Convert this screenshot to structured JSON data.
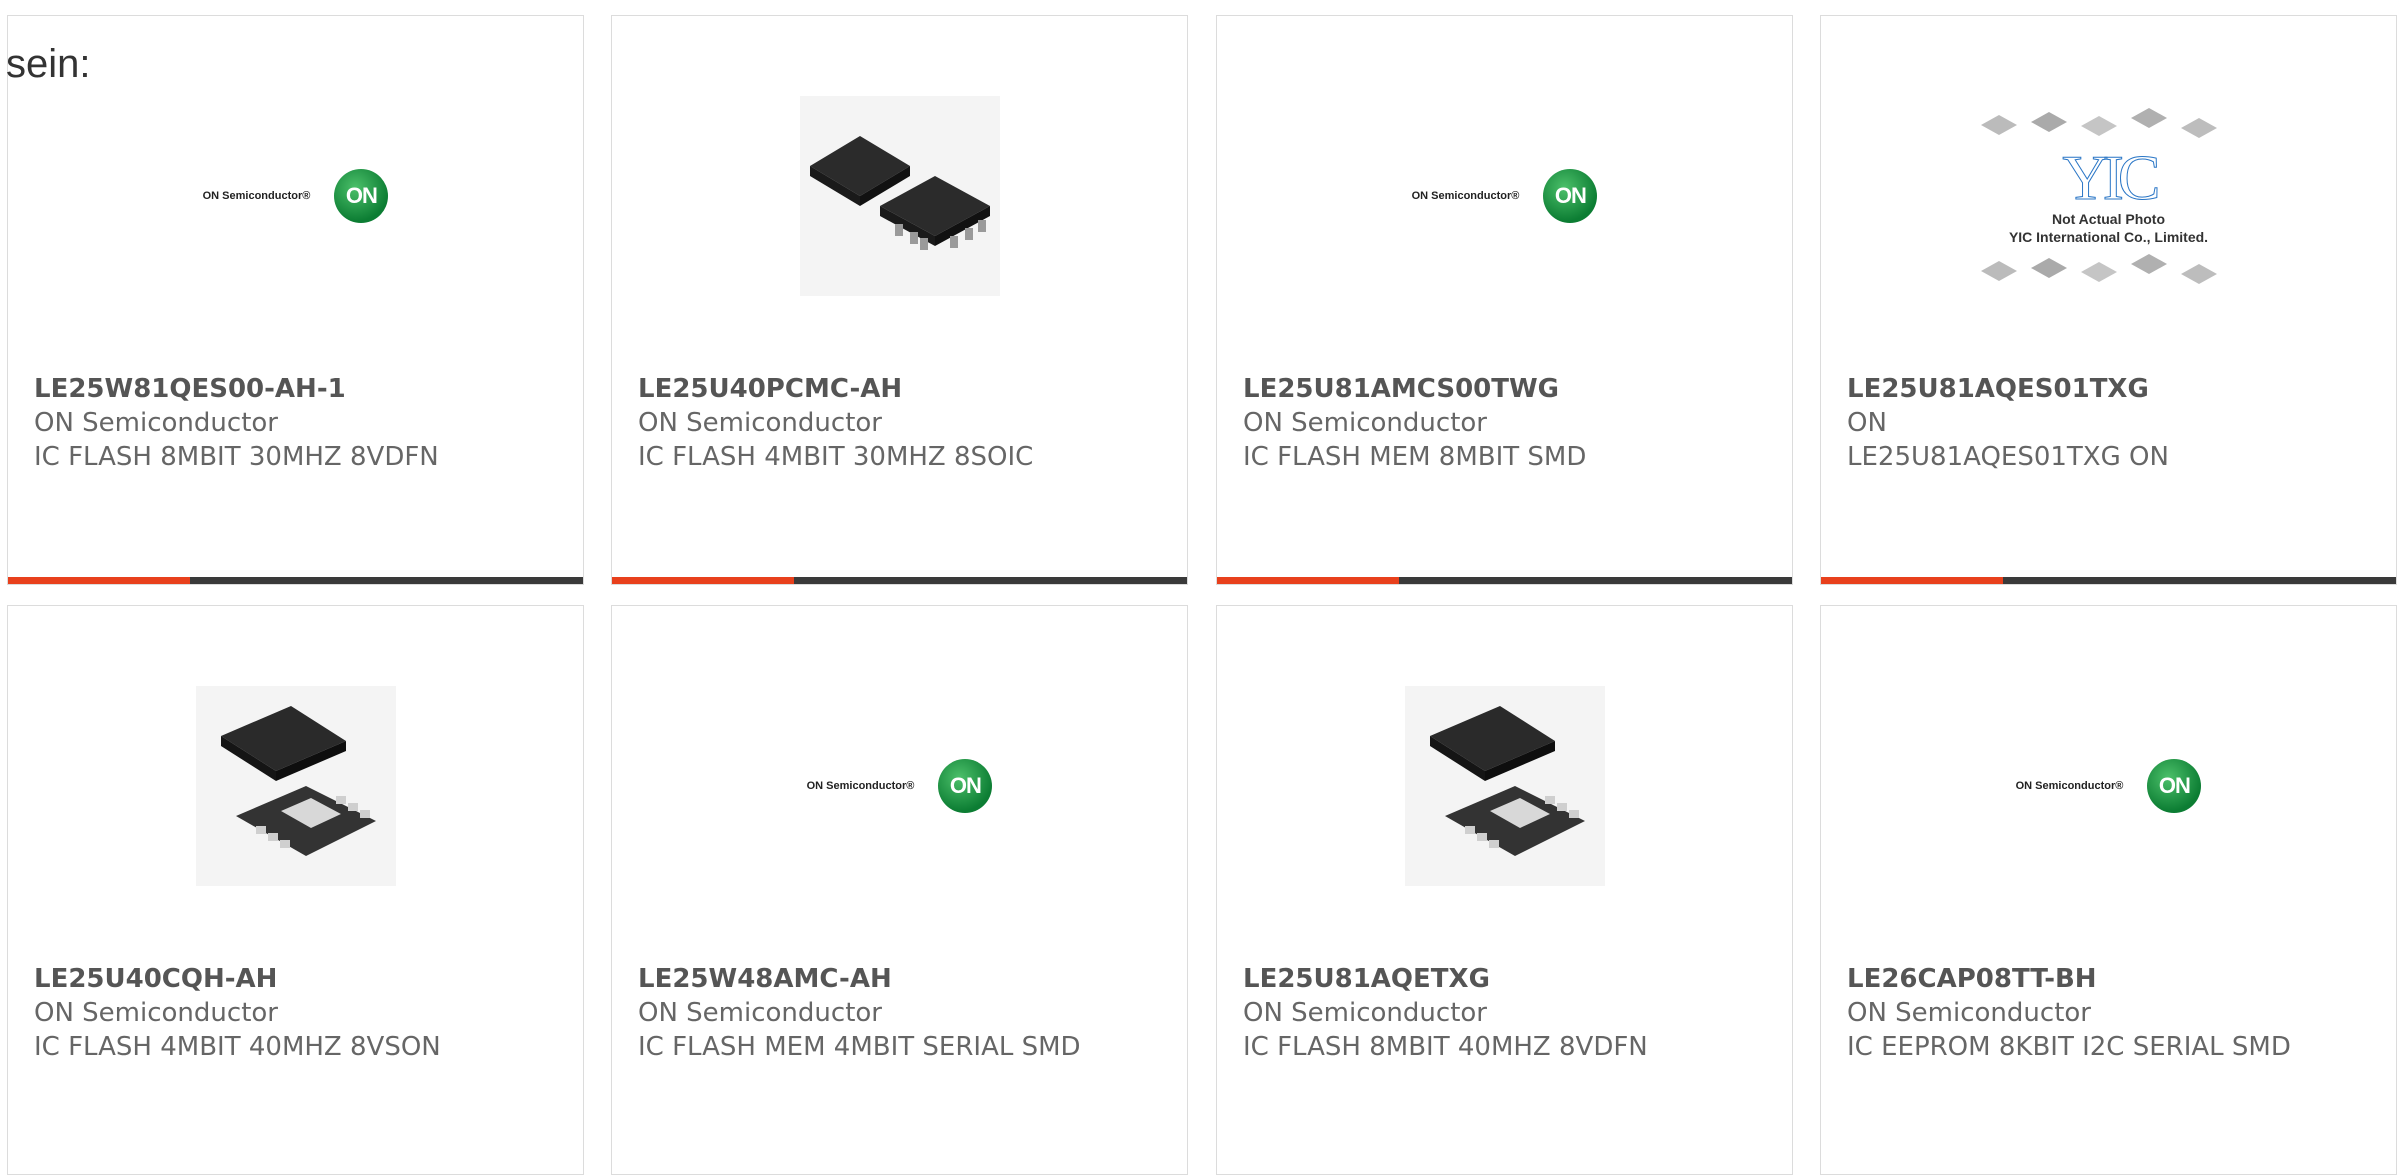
{
  "intro": {
    "text": "sein:"
  },
  "theme": {
    "accent": "#e8401c",
    "bar": "#3a3a3a",
    "on_green": "#1a9a45",
    "yic_blue": "#2a76c6"
  },
  "logos": {
    "on": {
      "company_text": "ON Semiconductor®",
      "badge": "ON"
    },
    "yic": {
      "mark": "YIC",
      "line1": "Not Actual Photo",
      "line2": "YIC International Co., Limited."
    }
  },
  "products": [
    {
      "part": "LE25W81QES00-AH-1",
      "maker": "ON Semiconductor",
      "desc": "IC FLASH 8MBIT 30MHZ 8VDFN",
      "image": "on-logo"
    },
    {
      "part": "LE25U40PCMC-AH",
      "maker": "ON Semiconductor",
      "desc": "IC FLASH 4MBIT 30MHZ 8SOIC",
      "image": "soic-chips"
    },
    {
      "part": "LE25U81AMCS00TWG",
      "maker": "ON Semiconductor",
      "desc": "IC FLASH MEM 8MBIT SMD",
      "image": "on-logo"
    },
    {
      "part": "LE25U81AQES01TXG",
      "maker": "ON",
      "desc": "LE25U81AQES01TXG ON",
      "image": "yic-placeholder"
    },
    {
      "part": "LE25U40CQH-AH",
      "maker": "ON Semiconductor",
      "desc": "IC FLASH 4MBIT 40MHZ 8VSON",
      "image": "vson-chips"
    },
    {
      "part": "LE25W48AMC-AH",
      "maker": "ON Semiconductor",
      "desc": "IC FLASH MEM 4MBIT SERIAL SMD",
      "image": "on-logo"
    },
    {
      "part": "LE25U81AQETXG",
      "maker": "ON Semiconductor",
      "desc": "IC FLASH 8MBIT 40MHZ 8VDFN",
      "image": "vson-chips"
    },
    {
      "part": "LE26CAP08TT-BH",
      "maker": "ON Semiconductor",
      "desc": "IC EEPROM 8KBIT I2C SERIAL SMD",
      "image": "on-logo"
    }
  ]
}
